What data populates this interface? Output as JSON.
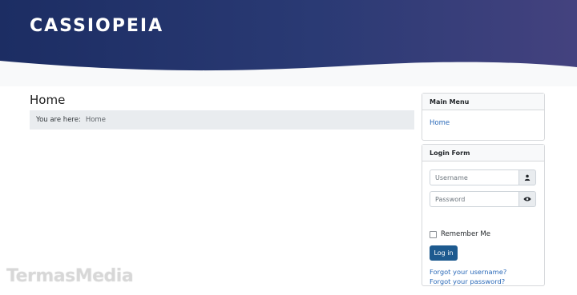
{
  "header": {
    "site_name": "CASSIOPEIA"
  },
  "page": {
    "title": "Home",
    "breadcrumb": {
      "prefix": "You are here:",
      "current": "Home"
    }
  },
  "main_menu": {
    "title": "Main Menu",
    "items": [
      {
        "label": "Home"
      }
    ]
  },
  "login_form": {
    "title": "Login Form",
    "username_placeholder": "Username",
    "password_placeholder": "Password",
    "remember_label": "Remember Me",
    "remember_checked": false,
    "login_label": "Log in",
    "forgot_username": "Forgot your username?",
    "forgot_password": "Forgot your password?",
    "username_icon": "user-icon",
    "password_icon": "eye-icon"
  },
  "watermark": "TermasMedia",
  "colors": {
    "header_start": "#1c2d63",
    "header_end": "#44427f",
    "link": "#2a69b8",
    "button": "#1d5a8f"
  }
}
